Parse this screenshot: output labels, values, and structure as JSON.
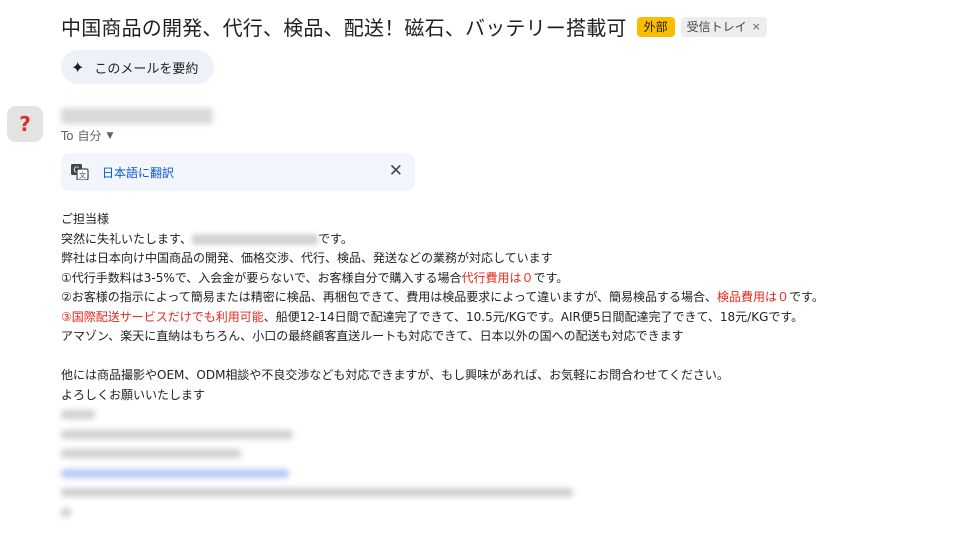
{
  "subject": "中国商品の開発、代行、検品、配送！磁石、バッテリー搭載可",
  "labels": {
    "external": "外部",
    "inbox": "受信トレイ",
    "inbox_remove": "×"
  },
  "summarize_label": "このメールを要約",
  "sender": {
    "avatar_glyph": "?",
    "recipient": "To 自分"
  },
  "translate": {
    "link": "日本語に翻訳",
    "close": "✕"
  },
  "body": {
    "greeting": "ご担当様",
    "intro_pre": "突然に失礼いたします、",
    "intro_post": "です。",
    "line1": "弊社は日本向け中国商品の開発、価格交渉、代行、検品、発送などの業務が対応しています",
    "line2_pre": "①代行手数料は3-5%で、入会金が要らないで、お客様自分で購入する場合",
    "line2_red": "代行費用は０",
    "line2_post": "です。",
    "line3_pre": "②お客様の指示によって簡易または精密に検品、再梱包できて、費用は検品要求によって違いますが、簡易検品する場合、",
    "line3_red": "検品費用は０",
    "line3_post": "です。",
    "line4_red": "③国際配送サービスだけでも利用可能",
    "line4_post": "、船便12-14日間で配達完了できて、10.5元/KGです。AIR便5日間配達完了できて、18元/KGです。",
    "line5": "アマゾン、楽天に直納はもちろん、小口の最終顧客直送ルートも対応できて、日本以外の国への配送も対応できます",
    "line6": "他には商品撮影やOEM、ODM相談や不良交渉なども対応できますが、もし興味があれば、お気軽にお問合わせてください。",
    "line7": "よろしくお願いいたします"
  }
}
